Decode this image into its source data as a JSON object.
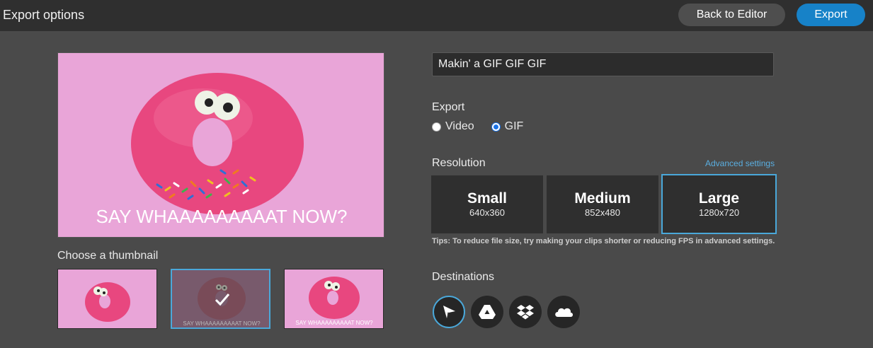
{
  "header": {
    "title": "Export options",
    "back_label": "Back to Editor",
    "export_label": "Export"
  },
  "preview": {
    "caption": "SAY WHAAAAAAAAAT NOW?"
  },
  "thumbnails": {
    "label": "Choose a thumbnail",
    "items": [
      {
        "caption": "",
        "selected": false
      },
      {
        "caption": "SAY WHAAAAAAAAAT NOW?",
        "selected": true
      },
      {
        "caption": "SAY WHAAAAAAAAAT NOW?",
        "selected": false
      }
    ]
  },
  "form": {
    "title_value": "Makin' a GIF GIF GIF",
    "export_label": "Export",
    "export_options": [
      {
        "label": "Video",
        "checked": false
      },
      {
        "label": "GIF",
        "checked": true
      }
    ],
    "resolution_label": "Resolution",
    "advanced_link": "Advanced settings",
    "resolutions": [
      {
        "name": "Small",
        "dims": "640x360",
        "selected": false
      },
      {
        "name": "Medium",
        "dims": "852x480",
        "selected": false
      },
      {
        "name": "Large",
        "dims": "1280x720",
        "selected": true
      }
    ],
    "tips": "Tips: To reduce file size, try making your clips shorter or reducing FPS in advanced settings.",
    "destinations_label": "Destinations",
    "destinations": [
      {
        "icon": "send-icon",
        "selected": true
      },
      {
        "icon": "google-drive-icon",
        "selected": false
      },
      {
        "icon": "dropbox-icon",
        "selected": false
      },
      {
        "icon": "onedrive-icon",
        "selected": false
      }
    ]
  },
  "colors": {
    "accent": "#1782c8",
    "selection": "#4aa8da",
    "background": "#4a4a4a",
    "topbar": "#2f2f2f",
    "preview_bg": "#e9a5d8",
    "donut": "#e8477f"
  }
}
